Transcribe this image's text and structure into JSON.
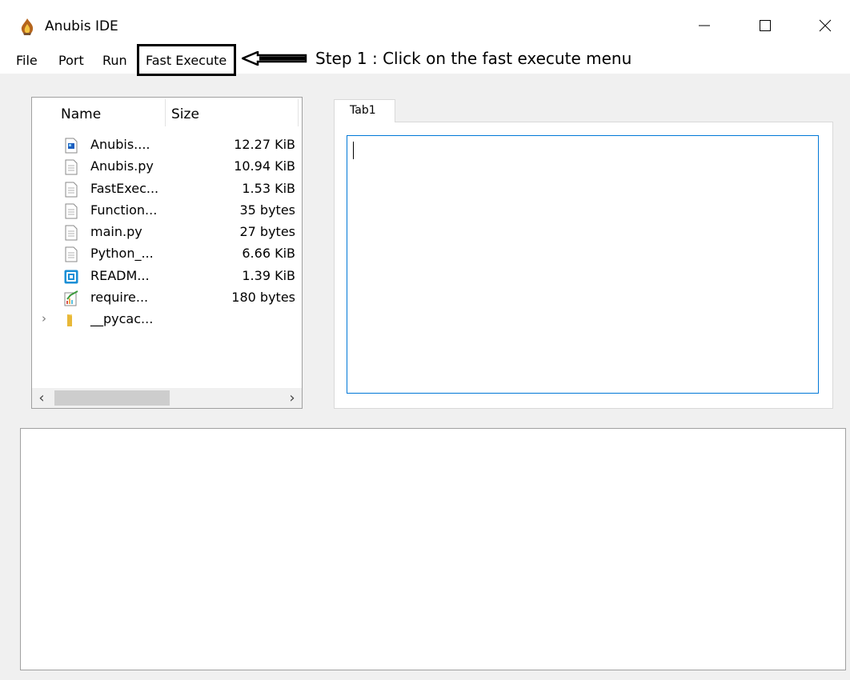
{
  "window": {
    "title": "Anubis IDE",
    "icon": "anubis-flame-icon",
    "controls": [
      "minimize-icon",
      "maximize-icon",
      "close-icon"
    ]
  },
  "menu": {
    "items": [
      {
        "label": "File"
      },
      {
        "label": "Port"
      },
      {
        "label": "Run"
      },
      {
        "label": "Fast Execute"
      }
    ]
  },
  "annotation": {
    "text": "Step 1 : Click on the fast execute menu",
    "color": "#000000"
  },
  "file_tree": {
    "columns": [
      "Name",
      "Size"
    ],
    "rows": [
      {
        "name": "Anubis....",
        "size": "12.27 KiB",
        "icon": "image-file-icon"
      },
      {
        "name": "Anubis.py",
        "size": "10.94 KiB",
        "icon": "text-file-icon"
      },
      {
        "name": "FastExec...",
        "size": "1.53 KiB",
        "icon": "text-file-icon"
      },
      {
        "name": "Function...",
        "size": "35 bytes",
        "icon": "text-file-icon"
      },
      {
        "name": "main.py",
        "size": "27 bytes",
        "icon": "text-file-icon"
      },
      {
        "name": "Python_...",
        "size": "6.66 KiB",
        "icon": "text-file-icon"
      },
      {
        "name": "READM...",
        "size": "1.39 KiB",
        "icon": "markdown-file-icon"
      },
      {
        "name": "require...",
        "size": "180 bytes",
        "icon": "spreadsheet-file-icon"
      },
      {
        "name": "__pycac...",
        "size": "",
        "icon": "folder-icon"
      }
    ]
  },
  "editor": {
    "tabs": [
      {
        "label": "Tab1"
      }
    ],
    "content": ""
  },
  "colors": {
    "accent": "#0078d7",
    "background": "#f0f0f0"
  }
}
